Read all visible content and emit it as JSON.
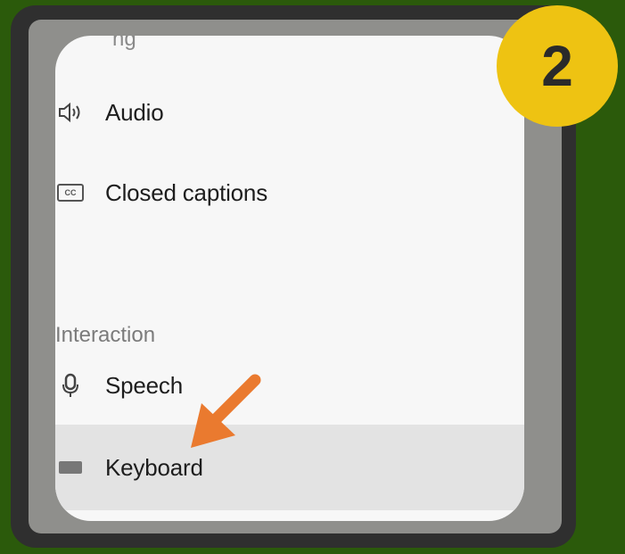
{
  "settings_nav": {
    "partial_item_label": "ng",
    "items": [
      {
        "label": "Audio",
        "icon": "speaker-icon"
      },
      {
        "label": "Closed captions",
        "icon": "closed-captions-icon"
      }
    ],
    "section_heading": "Interaction",
    "interaction_items": [
      {
        "label": "Speech",
        "icon": "microphone-icon"
      },
      {
        "label": "Keyboard",
        "icon": "keyboard-icon"
      }
    ]
  },
  "step_badge": {
    "number": "2"
  },
  "colors": {
    "background": "#2b5a0b",
    "badge": "#eec312",
    "arrow": "#ea7a2f",
    "selected_row": "#e3e3e3"
  }
}
